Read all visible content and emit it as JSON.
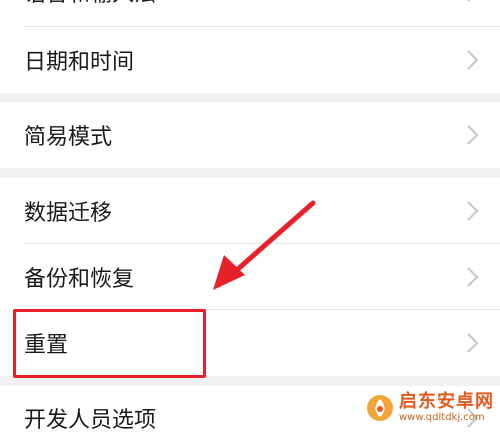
{
  "settings_list": {
    "group1": [
      {
        "label": "语言和输入法"
      },
      {
        "label": "日期和时间"
      }
    ],
    "group2": [
      {
        "label": "简易模式"
      }
    ],
    "group3": [
      {
        "label": "数据迁移"
      },
      {
        "label": "备份和恢复"
      },
      {
        "label": "重置"
      }
    ],
    "group4": [
      {
        "label": "开发人员选项"
      }
    ]
  },
  "annotation": {
    "highlight_color": "#e8202a",
    "arrow_color": "#e8202a",
    "highlighted_item": "重置"
  },
  "watermark": {
    "name": "启东安卓网",
    "url": "www.qdltdkj.com"
  },
  "colors": {
    "background": "#f2f2f2",
    "row_background": "#ffffff",
    "text": "#1a1a1a",
    "chevron": "#c7c7c7"
  }
}
